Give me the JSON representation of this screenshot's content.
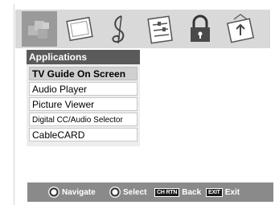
{
  "icons": [
    {
      "name": "applications-icon",
      "selected": true
    },
    {
      "name": "picture-icon",
      "selected": false
    },
    {
      "name": "audio-icon",
      "selected": false
    },
    {
      "name": "preferences-icon",
      "selected": false
    },
    {
      "name": "locks-icon",
      "selected": false
    },
    {
      "name": "setup-icon",
      "selected": false
    }
  ],
  "menu": {
    "title": "Applications",
    "items": [
      {
        "label": "TV Guide On Screen",
        "selected": true
      },
      {
        "label": "Audio Player",
        "selected": false
      },
      {
        "label": "Picture Viewer",
        "selected": false
      },
      {
        "label": "Digital CC/Audio Selector",
        "selected": false
      },
      {
        "label": "CableCARD",
        "selected": false
      }
    ]
  },
  "footer": {
    "navigate_label": "Navigate",
    "select_label": "Select",
    "ch_rtn_key": "CH RTN",
    "back_label": "Back",
    "exit_key": "EXIT",
    "exit_label": "Exit"
  }
}
